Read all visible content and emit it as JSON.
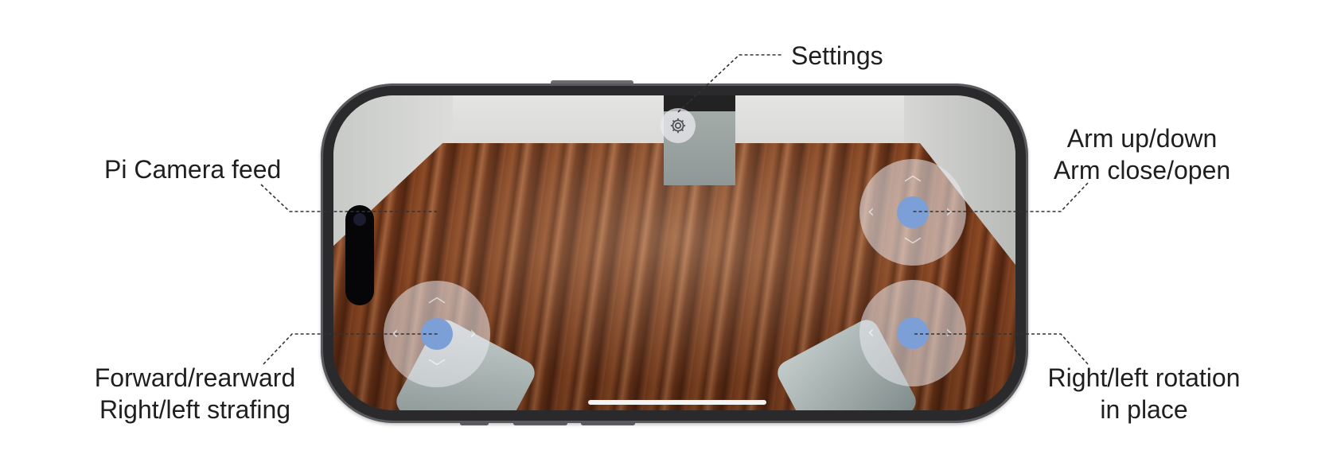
{
  "labels": {
    "settings": "Settings",
    "camera_feed": "Pi Camera feed",
    "arm_line1": "Arm up/down",
    "arm_line2": "Arm close/open",
    "drive_line1": "Forward/rearward",
    "drive_line2": "Right/left strafing",
    "rotate_line1": "Right/left rotation",
    "rotate_line2": "in place"
  },
  "icons": {
    "settings": "gear-icon",
    "joystick_arrows": [
      "chevron-up-icon",
      "chevron-down-icon",
      "chevron-left-icon",
      "chevron-right-icon"
    ]
  },
  "colors": {
    "knob": "#7d9fd8",
    "joystick_base": "rgba(235,235,240,0.55)",
    "phone_frame": "#2a2a2d",
    "label_text": "#1f1f1f"
  }
}
